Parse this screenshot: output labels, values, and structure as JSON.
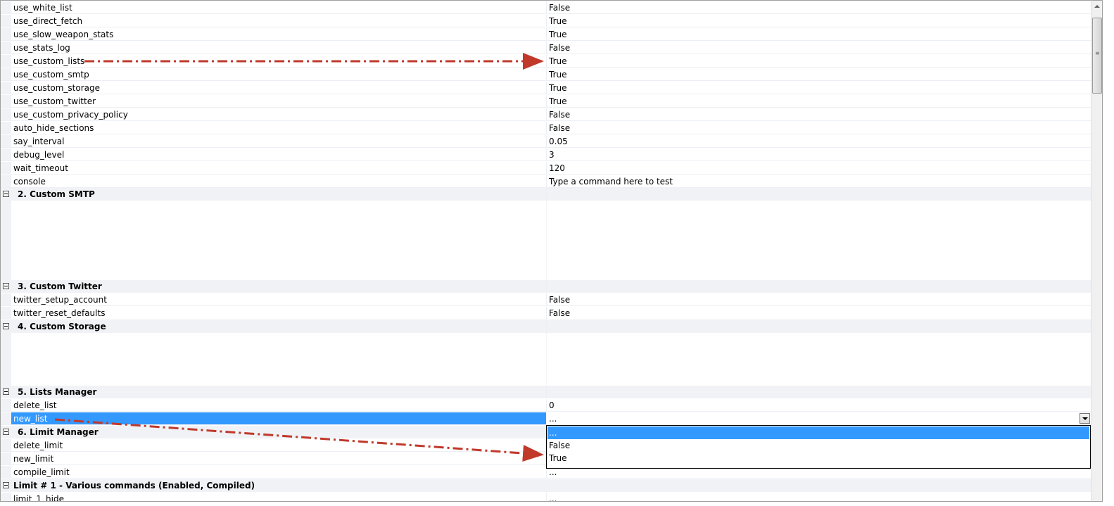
{
  "rows_top": [
    {
      "name": "use_white_list",
      "value": "False"
    },
    {
      "name": "use_direct_fetch",
      "value": "True"
    },
    {
      "name": "use_slow_weapon_stats",
      "value": "True"
    },
    {
      "name": "use_stats_log",
      "value": "False"
    },
    {
      "name": "use_custom_lists",
      "value": "True"
    },
    {
      "name": "use_custom_smtp",
      "value": "True"
    },
    {
      "name": "use_custom_storage",
      "value": "True"
    },
    {
      "name": "use_custom_twitter",
      "value": "True"
    },
    {
      "name": "use_custom_privacy_policy",
      "value": "False"
    },
    {
      "name": "auto_hide_sections",
      "value": "False"
    },
    {
      "name": "say_interval",
      "value": "0.05"
    },
    {
      "name": "debug_level",
      "value": "3"
    },
    {
      "name": "wait_timeout",
      "value": "120"
    },
    {
      "name": "console",
      "value": "Type a command here to test"
    }
  ],
  "categories": {
    "smtp": "2. Custom SMTP",
    "twitter": "3. Custom Twitter",
    "storage": "4. Custom Storage",
    "lists": "5. Lists Manager",
    "limit": "6. Limit Manager",
    "limit1": "Limit # 1 - Various commands (Enabled, Compiled)"
  },
  "twitter_rows": [
    {
      "name": "twitter_setup_account",
      "value": "False"
    },
    {
      "name": "twitter_reset_defaults",
      "value": "False"
    }
  ],
  "lists_rows": [
    {
      "name": "delete_list",
      "value": "0"
    },
    {
      "name": "new_list",
      "value": "..."
    }
  ],
  "limit_rows": [
    {
      "name": "delete_limit",
      "value": ""
    },
    {
      "name": "new_limit",
      "value": ""
    },
    {
      "name": "compile_limit",
      "value": "..."
    }
  ],
  "limit1_rows": [
    {
      "name": "limit_1_hide",
      "value": "..."
    }
  ],
  "dropdown": {
    "current": "...",
    "options": [
      "...",
      "False",
      "True"
    ],
    "selected_index": 0
  },
  "colors": {
    "selection": "#3399ff",
    "arrow": "#c0392b",
    "category_bg": "#f0f2f6"
  }
}
